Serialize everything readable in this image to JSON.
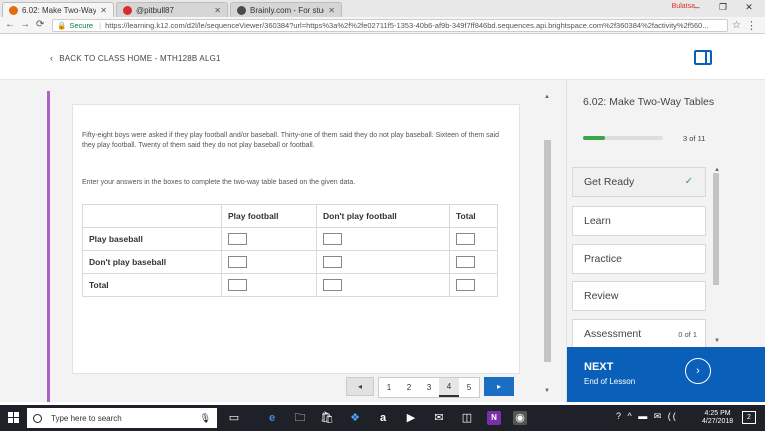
{
  "browser": {
    "tabs": [
      {
        "title": "6.02: Make Two-Way Ta",
        "color": "#e86a10",
        "active": true
      },
      {
        "title": "@pitbull87",
        "color": "#d82c2c",
        "active": false
      },
      {
        "title": "Brainly.com - For studen",
        "color": "#4a4a4a",
        "active": false
      }
    ],
    "profile": "Bulatsa",
    "secure_label": "Secure",
    "url": "https://learning.k12.com/d2l/le/sequenceViewer/360384?url=https%3a%2f%2fe02711f5-1353-40b6-af9b-349f7ff846bd.sequences.api.brightspace.com%2f360384%2factivity%2f560..."
  },
  "header": {
    "back_label": "BACK TO CLASS HOME - MTH128B ALG1"
  },
  "problem": {
    "text": "Fifty-eight boys were asked if they play football and/or baseball. Thirty-one of them said they do not play baseball. Sixteen of them said they play football. Twenty of them said they do not play baseball or football.",
    "instruction": "Enter your answers in the boxes to complete the two-way table based on the given data.",
    "table": {
      "columns": [
        "",
        "Play football",
        "Don't play football",
        "Total"
      ],
      "rows": [
        "Play baseball",
        "Don't play baseball",
        "Total"
      ]
    }
  },
  "pagination": {
    "pages": [
      "1",
      "2",
      "3",
      "4",
      "5"
    ],
    "current": "4",
    "prev": "◂",
    "next": "▸"
  },
  "sidebar": {
    "lesson_title": "6.02: Make Two-Way Tables",
    "progress_text": "3 of 11",
    "progress_fraction": 0.27,
    "steps": [
      {
        "label": "Get Ready",
        "done": true
      },
      {
        "label": "Learn"
      },
      {
        "label": "Practice"
      },
      {
        "label": "Review"
      },
      {
        "label": "Assessment",
        "count": "0 of 1"
      }
    ],
    "next_label": "NEXT",
    "next_sub": "End of Lesson"
  },
  "taskbar": {
    "search_placeholder": "Type here to search",
    "time": "4:25 PM",
    "date": "4/27/2018",
    "notifications": "2"
  }
}
